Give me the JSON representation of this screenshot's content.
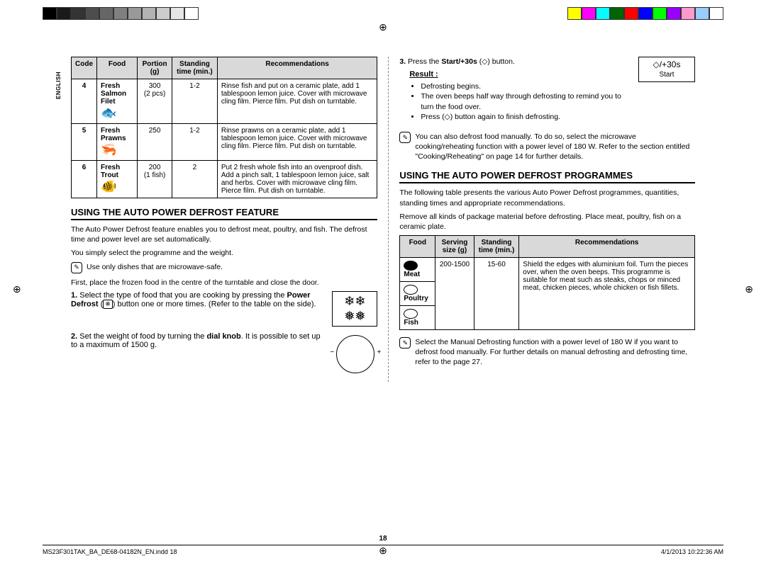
{
  "side_label": "ENGLISH",
  "table1": {
    "headers": [
      "Code",
      "Food",
      "Portion (g)",
      "Standing time (min.)",
      "Recommendations"
    ],
    "rows": [
      {
        "code": "4",
        "food": "Fresh Salmon Filet",
        "icon": "🐟",
        "portion": "300",
        "portion_note": "(2 pcs)",
        "time": "1-2",
        "rec": "Rinse fish and put on a ceramic plate, add 1 tablespoon lemon juice. Cover with microwave cling film. Pierce film. Put dish on turntable."
      },
      {
        "code": "5",
        "food": "Fresh Prawns",
        "icon": "🦐",
        "portion": "250",
        "portion_note": "",
        "time": "1-2",
        "rec": "Rinse prawns on a ceramic plate, add 1 tablespoon lemon juice. Cover with microwave cling film. Pierce film. Put dish on turntable."
      },
      {
        "code": "6",
        "food": "Fresh Trout",
        "icon": "🐠",
        "portion": "200",
        "portion_note": "(1 fish)",
        "time": "2",
        "rec": "Put 2 fresh whole fish into an ovenproof dish. Add a pinch salt, 1 tablespoon lemon juice, salt and herbs. Cover with microwave cling film. Pierce film. Put dish on turntable."
      }
    ]
  },
  "section_feature": {
    "title": "USING THE AUTO POWER DEFROST FEATURE",
    "intro1": "The Auto Power Defrost feature enables you to defrost meat, poultry, and fish. The defrost time and power level are set automatically.",
    "intro2": "You simply select the programme and the weight.",
    "note1": "Use only dishes that are microwave-safe.",
    "pre_steps": "First, place the frozen food in the centre of the turntable and close the door.",
    "step1_a": "Select the type of food that you are cooking by pressing the ",
    "step1_b": "Power Defrost",
    "step1_c": " button one or more times. (Refer to the table on the side).",
    "step1_icon": "❄❄\n❅❅",
    "step2_a": "Set the weight of food by turning the ",
    "step2_b": "dial knob",
    "step2_c": ". It is possible to set up to a maximum of 1500 g."
  },
  "section_right": {
    "step3_a": "Press the ",
    "step3_b": "Start/+30s",
    "step3_c": " button.",
    "button_label": "◇/+30s\nStart",
    "result_label": "Result :",
    "results": [
      "Defrosting begins.",
      "The oven beeps half way through defrosting to remind you to turn the food over.",
      "Press (◇) button again to finish defrosting."
    ],
    "note2": "You can also defrost food manually. To do so, select the microwave cooking/reheating function with a power level of 180 W. Refer to the section entitled \"Cooking/Reheating\" on page 14 for further details."
  },
  "section_programmes": {
    "title": "USING THE AUTO POWER DEFROST PROGRAMMES",
    "intro1": "The following table presents the various Auto Power Defrost programmes, quantities, standing times and appropriate recommendations.",
    "intro2": "Remove all kinds of package material before defrosting. Place meat, poultry, fish on a ceramic plate.",
    "headers": [
      "Food",
      "Serving size (g)",
      "Standing time (min.)",
      "Recommendations"
    ],
    "foods": [
      "Meat",
      "Poultry",
      "Fish"
    ],
    "serving": "200-1500",
    "standing": "15-60",
    "rec": "Shield the edges with aluminium foil. Turn the pieces over, when the oven beeps. This programme is suitable for meat such as steaks, chops or minced meat, chicken pieces, whole chicken or fish fillets.",
    "note3": "Select the Manual Defrosting function with a power level of 180 W if you want to defrost food manually. For further details on manual defrosting and defrosting time, refer to the page 27."
  },
  "page_num": "18",
  "footer_left": "MS23F301TAK_BA_DE68-04182N_EN.indd   18",
  "footer_right": "4/1/2013   10:22:36 AM"
}
